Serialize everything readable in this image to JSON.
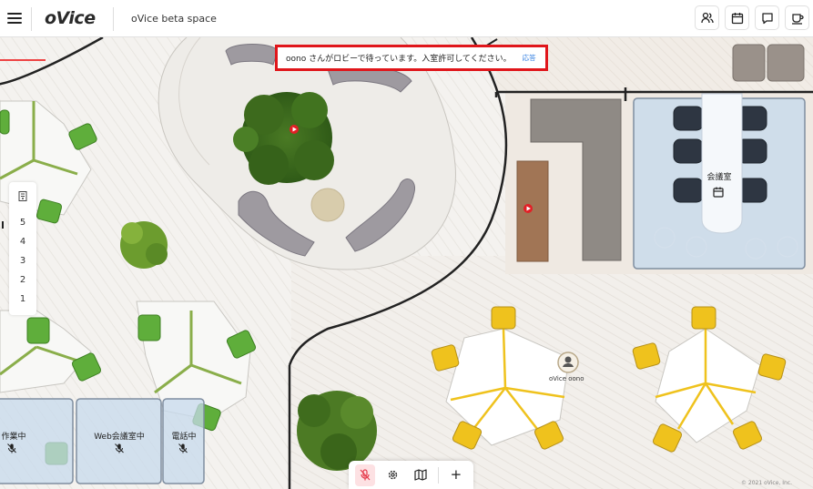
{
  "app": {
    "logo": "oVice",
    "space_title": "oVice beta space"
  },
  "top_icons": [
    "users-icon",
    "calendar-icon",
    "chat-icon",
    "cup-icon"
  ],
  "notification": {
    "message": "oono さんがロビーで待っています。入室許可してください。",
    "action_label": "応答",
    "border_color": "#e0161b",
    "action_color": "#2f7de1"
  },
  "floor_panel": {
    "floors": [
      "5",
      "4",
      "3",
      "2",
      "1"
    ],
    "active_floor": "5"
  },
  "rooms": {
    "meeting_room": "会議室",
    "working": "作業中",
    "web_meeting": "Web会議室中",
    "on_call": "電話中"
  },
  "avatar": {
    "name": "oVice oono"
  },
  "bottom_toolbar": {
    "add_label": "+"
  },
  "footer": {
    "copyright": "© 2021 oVice, Inc."
  },
  "colors": {
    "desk_green": "#5fae3b",
    "chair_yellow": "#efc21d",
    "room_blue": "#c7d9ec",
    "mic_muted_bg": "#fde1e3"
  }
}
